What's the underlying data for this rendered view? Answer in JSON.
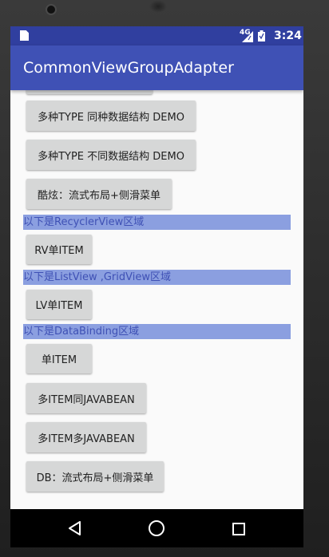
{
  "status_bar": {
    "network": "4G",
    "time": "3:24"
  },
  "app_bar": {
    "title": "CommonViewGroupAdapter"
  },
  "buttons": [
    "多种TYPE 同种数据结构 DEMO",
    "多种TYPE 不同数据结构 DEMO",
    "酷炫：流式布局+侧滑菜单",
    "RV单ITEM",
    "LV单ITEM",
    "单ITEM",
    "多ITEM同JAVABEAN",
    "多ITEM多JAVABEAN",
    "DB：流式布局+侧滑菜单"
  ],
  "sections": [
    "以下是RecyclerView区域",
    "以下是ListView ,GridView区域",
    "以下是DataBinding区域"
  ],
  "colors": {
    "primary": "#3f51b5",
    "primary_dark": "#303f9f",
    "section_band": "#8b9fe0",
    "button": "#d6d7d7"
  }
}
